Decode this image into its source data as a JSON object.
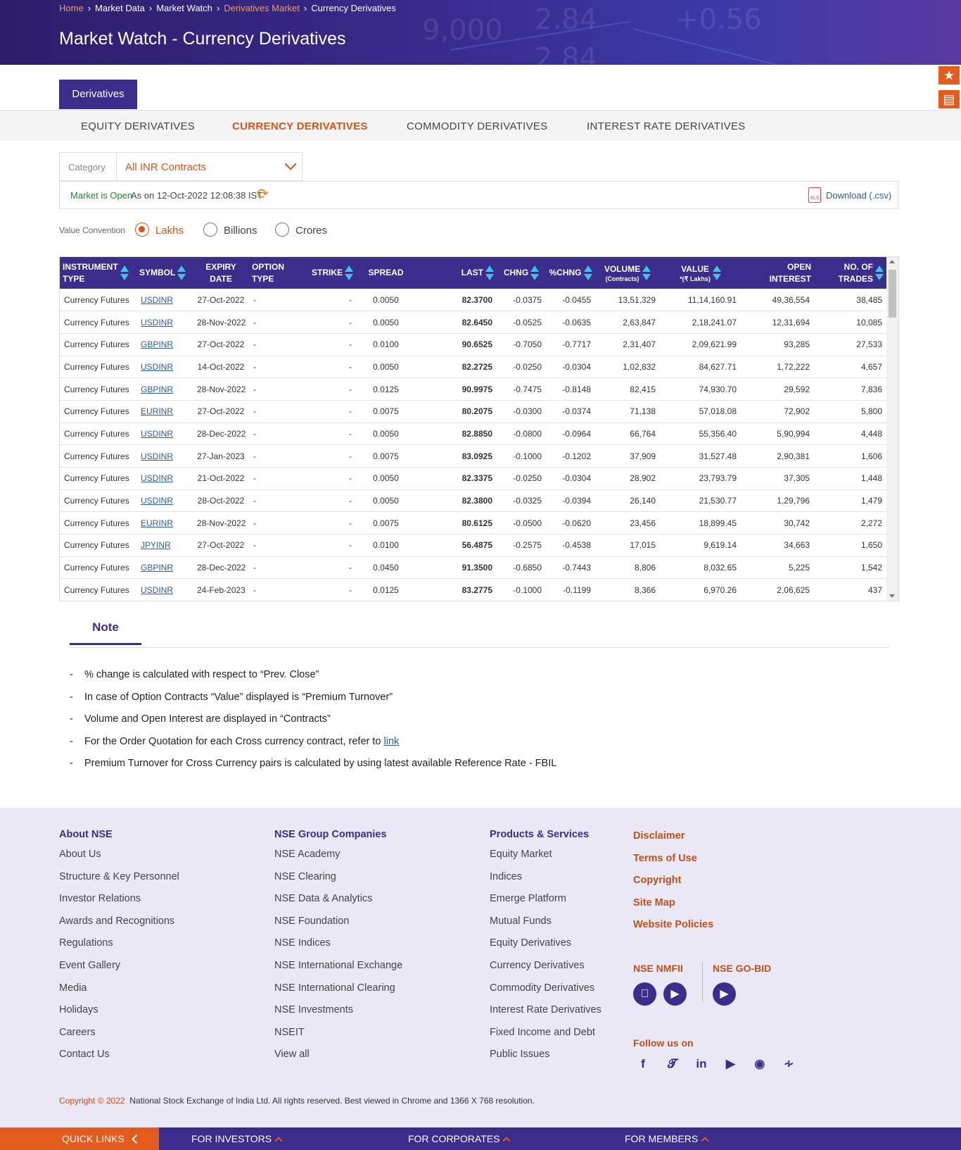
{
  "breadcrumb": [
    "Home",
    "Market Data",
    "Market Watch",
    "Derivatives Market",
    "Currency Derivatives"
  ],
  "hero_bg_numbers": [
    "9,000",
    "2.84",
    "+0.56",
    "2.84"
  ],
  "page_title": "Market Watch - Currency Derivatives",
  "side_tools": [
    "accessibility-icon",
    "document-icon",
    "login-icon"
  ],
  "main_tab": "Derivatives",
  "subnav": [
    "EQUITY DERIVATIVES",
    "CURRENCY DERIVATIVES",
    "COMMODITY DERIVATIVES",
    "INTEREST RATE DERIVATIVES"
  ],
  "subnav_active": "CURRENCY DERIVATIVES",
  "category": {
    "label": "Category",
    "value": "All INR Contracts"
  },
  "status": {
    "open": "Market is Open",
    "as_on": "As on 12-Oct-2022 12:08:38 IST",
    "xls": "XLS",
    "download": "Download (.csv)"
  },
  "value_convention": {
    "label": "Value Convention",
    "options": [
      "Lakhs",
      "Billions",
      "Crores"
    ],
    "selected": "Lakhs"
  },
  "table": {
    "headers": [
      {
        "l1": "INSTRUMENT",
        "l2": "TYPE"
      },
      {
        "l1": "SYMBOL",
        "l2": ""
      },
      {
        "l1": "EXPIRY",
        "l2": "DATE"
      },
      {
        "l1": "OPTION",
        "l2": "TYPE"
      },
      {
        "l1": "STRIKE",
        "l2": ""
      },
      {
        "l1": "SPREAD",
        "l2": ""
      },
      {
        "l1": "LAST",
        "l2": ""
      },
      {
        "l1": "CHNG",
        "l2": ""
      },
      {
        "l1": "%CHNG",
        "l2": ""
      },
      {
        "l1": "VOLUME",
        "l2": "(Contracts)"
      },
      {
        "l1": "VALUE",
        "l2": "*(₹ Lakhs)"
      },
      {
        "l1": "OPEN",
        "l2": "INTEREST"
      },
      {
        "l1": "NO. OF",
        "l2": "TRADES"
      }
    ],
    "rows": [
      [
        "Currency Futures",
        "USDINR",
        "27-Oct-2022",
        "-",
        "-",
        "0.0050",
        "82.3700",
        "-0.0375",
        "-0.0455",
        "13,51,329",
        "11,14,160.91",
        "49,36,554",
        "38,485"
      ],
      [
        "Currency Futures",
        "USDINR",
        "28-Nov-2022",
        "-",
        "-",
        "0.0050",
        "82.6450",
        "-0.0525",
        "-0.0635",
        "2,63,847",
        "2,18,241.07",
        "12,31,694",
        "10,085"
      ],
      [
        "Currency Futures",
        "GBPINR",
        "27-Oct-2022",
        "-",
        "-",
        "0.0100",
        "90.6525",
        "-0.7050",
        "-0.7717",
        "2,31,407",
        "2,09,621.99",
        "93,285",
        "27,533"
      ],
      [
        "Currency Futures",
        "USDINR",
        "14-Oct-2022",
        "-",
        "-",
        "0.0050",
        "82.2725",
        "-0.0250",
        "-0.0304",
        "1,02,832",
        "84,627.71",
        "1,72,222",
        "4,657"
      ],
      [
        "Currency Futures",
        "GBPINR",
        "28-Nov-2022",
        "-",
        "-",
        "0.0125",
        "90.9975",
        "-0.7475",
        "-0.8148",
        "82,415",
        "74,930.70",
        "29,592",
        "7,836"
      ],
      [
        "Currency Futures",
        "EURINR",
        "27-Oct-2022",
        "-",
        "-",
        "0.0075",
        "80.2075",
        "-0.0300",
        "-0.0374",
        "71,138",
        "57,018.08",
        "72,902",
        "5,800"
      ],
      [
        "Currency Futures",
        "USDINR",
        "28-Dec-2022",
        "-",
        "-",
        "0.0050",
        "82.8850",
        "-0.0800",
        "-0.0964",
        "66,764",
        "55,356.40",
        "5,90,994",
        "4,448"
      ],
      [
        "Currency Futures",
        "USDINR",
        "27-Jan-2023",
        "-",
        "-",
        "0.0075",
        "83.0925",
        "-0.1000",
        "-0.1202",
        "37,909",
        "31,527.48",
        "2,90,381",
        "1,606"
      ],
      [
        "Currency Futures",
        "USDINR",
        "21-Oct-2022",
        "-",
        "-",
        "0.0050",
        "82.3375",
        "-0.0250",
        "-0.0304",
        "28,902",
        "23,793.79",
        "37,305",
        "1,448"
      ],
      [
        "Currency Futures",
        "USDINR",
        "28-Oct-2022",
        "-",
        "-",
        "0.0050",
        "82.3800",
        "-0.0325",
        "-0.0394",
        "26,140",
        "21,530.77",
        "1,29,796",
        "1,479"
      ],
      [
        "Currency Futures",
        "EURINR",
        "28-Nov-2022",
        "-",
        "-",
        "0.0075",
        "80.6125",
        "-0.0500",
        "-0.0620",
        "23,456",
        "18,899.45",
        "30,742",
        "2,272"
      ],
      [
        "Currency Futures",
        "JPYINR",
        "27-Oct-2022",
        "-",
        "-",
        "0.0100",
        "56.4875",
        "-0.2575",
        "-0.4538",
        "17,015",
        "9,619.14",
        "34,663",
        "1,650"
      ],
      [
        "Currency Futures",
        "GBPINR",
        "28-Dec-2022",
        "-",
        "-",
        "0.0450",
        "91.3500",
        "-0.6850",
        "-0.7443",
        "8,806",
        "8,032.65",
        "5,225",
        "1,542"
      ],
      [
        "Currency Futures",
        "USDINR",
        "24-Feb-2023",
        "-",
        "-",
        "0.0125",
        "83.2775",
        "-0.1000",
        "-0.1199",
        "8,366",
        "6,970.26",
        "2,06,625",
        "437"
      ]
    ]
  },
  "note": {
    "tab": "Note",
    "items": [
      {
        "text": "% change is calculated with respect to “Prev. Close”",
        "link": ""
      },
      {
        "text": "In case of Option Contracts “Value” displayed is “Premium Turnover”",
        "link": ""
      },
      {
        "text": "Volume and Open Interest are displayed in “Contracts”",
        "link": ""
      },
      {
        "text": "For the Order Quotation for each Cross currency contract, refer to ",
        "link": "link"
      },
      {
        "text": "Premium Turnover for Cross Currency pairs is calculated by using latest available Reference Rate - FBIL",
        "link": ""
      }
    ]
  },
  "footer": {
    "columns": [
      {
        "title": "About NSE",
        "links": [
          "About Us",
          "Structure & Key Personnel",
          "Investor Relations",
          "Awards and Recognitions",
          "Regulations",
          "Event Gallery",
          "Media",
          "Holidays",
          "Careers",
          "Contact Us"
        ]
      },
      {
        "title": "NSE Group Companies",
        "links": [
          "NSE Academy",
          "NSE Clearing",
          "NSE Data & Analytics",
          "NSE Foundation",
          "NSE Indices",
          "NSE International Exchange",
          "NSE International Clearing",
          "NSE Investments",
          "NSEIT",
          "View all"
        ]
      },
      {
        "title": "Products & Services",
        "links": [
          "Equity Market",
          "Indices",
          "Emerge Platform",
          "Mutual Funds",
          "Equity Derivatives",
          "Currency Derivatives",
          "Commodity Derivatives",
          "Interest Rate Derivatives",
          "Fixed Income and Debt",
          "Public Issues"
        ]
      }
    ],
    "legal": [
      "Disclaimer",
      "Terms of Use",
      "Copyright",
      "Site Map",
      "Website Policies"
    ],
    "apps": {
      "nmfii": "NSE NMFII",
      "gobid": "NSE GO-BID"
    },
    "follow": "Follow us on",
    "social": [
      "facebook-icon",
      "twitter-icon",
      "linkedin-icon",
      "youtube-icon",
      "instagram-icon",
      "rss-icon"
    ],
    "copyright_year": "Copyright © 2022",
    "copyright_text": "National Stock Exchange of India Ltd. All rights reserved. Best viewed in Chrome and 1366 X 768 resolution."
  },
  "bottom_bar": {
    "quick_links": "QUICK LINKS",
    "items": [
      "FOR INVESTORS",
      "FOR CORPORATES",
      "FOR MEMBERS"
    ]
  },
  "colors": {
    "brand_purple": "#3c2d8c",
    "accent_orange": "#e35b1d",
    "negative": "#e0232f",
    "sort_arrow": "#36c6e6"
  }
}
